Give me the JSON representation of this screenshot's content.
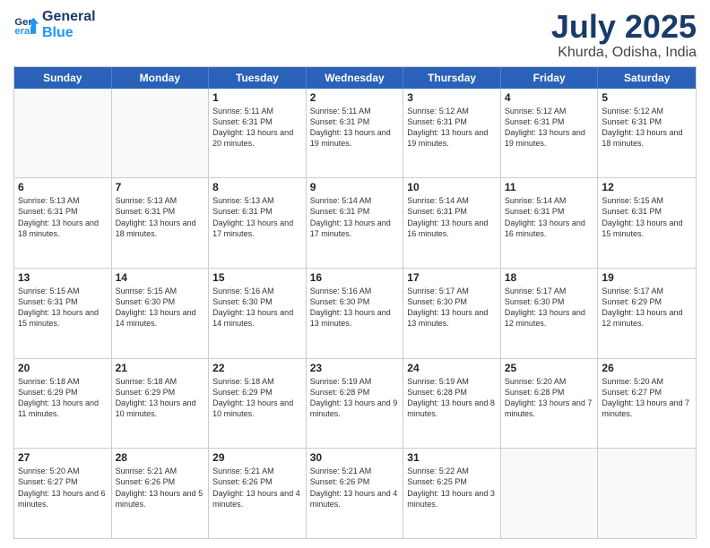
{
  "header": {
    "logo_line1": "General",
    "logo_line2": "Blue",
    "month_title": "July 2025",
    "location": "Khurda, Odisha, India"
  },
  "days_of_week": [
    "Sunday",
    "Monday",
    "Tuesday",
    "Wednesday",
    "Thursday",
    "Friday",
    "Saturday"
  ],
  "rows": [
    [
      {
        "day": "",
        "empty": true
      },
      {
        "day": "",
        "empty": true
      },
      {
        "day": "1",
        "sunrise": "Sunrise: 5:11 AM",
        "sunset": "Sunset: 6:31 PM",
        "daylight": "Daylight: 13 hours and 20 minutes."
      },
      {
        "day": "2",
        "sunrise": "Sunrise: 5:11 AM",
        "sunset": "Sunset: 6:31 PM",
        "daylight": "Daylight: 13 hours and 19 minutes."
      },
      {
        "day": "3",
        "sunrise": "Sunrise: 5:12 AM",
        "sunset": "Sunset: 6:31 PM",
        "daylight": "Daylight: 13 hours and 19 minutes."
      },
      {
        "day": "4",
        "sunrise": "Sunrise: 5:12 AM",
        "sunset": "Sunset: 6:31 PM",
        "daylight": "Daylight: 13 hours and 19 minutes."
      },
      {
        "day": "5",
        "sunrise": "Sunrise: 5:12 AM",
        "sunset": "Sunset: 6:31 PM",
        "daylight": "Daylight: 13 hours and 18 minutes."
      }
    ],
    [
      {
        "day": "6",
        "sunrise": "Sunrise: 5:13 AM",
        "sunset": "Sunset: 6:31 PM",
        "daylight": "Daylight: 13 hours and 18 minutes."
      },
      {
        "day": "7",
        "sunrise": "Sunrise: 5:13 AM",
        "sunset": "Sunset: 6:31 PM",
        "daylight": "Daylight: 13 hours and 18 minutes."
      },
      {
        "day": "8",
        "sunrise": "Sunrise: 5:13 AM",
        "sunset": "Sunset: 6:31 PM",
        "daylight": "Daylight: 13 hours and 17 minutes."
      },
      {
        "day": "9",
        "sunrise": "Sunrise: 5:14 AM",
        "sunset": "Sunset: 6:31 PM",
        "daylight": "Daylight: 13 hours and 17 minutes."
      },
      {
        "day": "10",
        "sunrise": "Sunrise: 5:14 AM",
        "sunset": "Sunset: 6:31 PM",
        "daylight": "Daylight: 13 hours and 16 minutes."
      },
      {
        "day": "11",
        "sunrise": "Sunrise: 5:14 AM",
        "sunset": "Sunset: 6:31 PM",
        "daylight": "Daylight: 13 hours and 16 minutes."
      },
      {
        "day": "12",
        "sunrise": "Sunrise: 5:15 AM",
        "sunset": "Sunset: 6:31 PM",
        "daylight": "Daylight: 13 hours and 15 minutes."
      }
    ],
    [
      {
        "day": "13",
        "sunrise": "Sunrise: 5:15 AM",
        "sunset": "Sunset: 6:31 PM",
        "daylight": "Daylight: 13 hours and 15 minutes."
      },
      {
        "day": "14",
        "sunrise": "Sunrise: 5:15 AM",
        "sunset": "Sunset: 6:30 PM",
        "daylight": "Daylight: 13 hours and 14 minutes."
      },
      {
        "day": "15",
        "sunrise": "Sunrise: 5:16 AM",
        "sunset": "Sunset: 6:30 PM",
        "daylight": "Daylight: 13 hours and 14 minutes."
      },
      {
        "day": "16",
        "sunrise": "Sunrise: 5:16 AM",
        "sunset": "Sunset: 6:30 PM",
        "daylight": "Daylight: 13 hours and 13 minutes."
      },
      {
        "day": "17",
        "sunrise": "Sunrise: 5:17 AM",
        "sunset": "Sunset: 6:30 PM",
        "daylight": "Daylight: 13 hours and 13 minutes."
      },
      {
        "day": "18",
        "sunrise": "Sunrise: 5:17 AM",
        "sunset": "Sunset: 6:30 PM",
        "daylight": "Daylight: 13 hours and 12 minutes."
      },
      {
        "day": "19",
        "sunrise": "Sunrise: 5:17 AM",
        "sunset": "Sunset: 6:29 PM",
        "daylight": "Daylight: 13 hours and 12 minutes."
      }
    ],
    [
      {
        "day": "20",
        "sunrise": "Sunrise: 5:18 AM",
        "sunset": "Sunset: 6:29 PM",
        "daylight": "Daylight: 13 hours and 11 minutes."
      },
      {
        "day": "21",
        "sunrise": "Sunrise: 5:18 AM",
        "sunset": "Sunset: 6:29 PM",
        "daylight": "Daylight: 13 hours and 10 minutes."
      },
      {
        "day": "22",
        "sunrise": "Sunrise: 5:18 AM",
        "sunset": "Sunset: 6:29 PM",
        "daylight": "Daylight: 13 hours and 10 minutes."
      },
      {
        "day": "23",
        "sunrise": "Sunrise: 5:19 AM",
        "sunset": "Sunset: 6:28 PM",
        "daylight": "Daylight: 13 hours and 9 minutes."
      },
      {
        "day": "24",
        "sunrise": "Sunrise: 5:19 AM",
        "sunset": "Sunset: 6:28 PM",
        "daylight": "Daylight: 13 hours and 8 minutes."
      },
      {
        "day": "25",
        "sunrise": "Sunrise: 5:20 AM",
        "sunset": "Sunset: 6:28 PM",
        "daylight": "Daylight: 13 hours and 7 minutes."
      },
      {
        "day": "26",
        "sunrise": "Sunrise: 5:20 AM",
        "sunset": "Sunset: 6:27 PM",
        "daylight": "Daylight: 13 hours and 7 minutes."
      }
    ],
    [
      {
        "day": "27",
        "sunrise": "Sunrise: 5:20 AM",
        "sunset": "Sunset: 6:27 PM",
        "daylight": "Daylight: 13 hours and 6 minutes."
      },
      {
        "day": "28",
        "sunrise": "Sunrise: 5:21 AM",
        "sunset": "Sunset: 6:26 PM",
        "daylight": "Daylight: 13 hours and 5 minutes."
      },
      {
        "day": "29",
        "sunrise": "Sunrise: 5:21 AM",
        "sunset": "Sunset: 6:26 PM",
        "daylight": "Daylight: 13 hours and 4 minutes."
      },
      {
        "day": "30",
        "sunrise": "Sunrise: 5:21 AM",
        "sunset": "Sunset: 6:26 PM",
        "daylight": "Daylight: 13 hours and 4 minutes."
      },
      {
        "day": "31",
        "sunrise": "Sunrise: 5:22 AM",
        "sunset": "Sunset: 6:25 PM",
        "daylight": "Daylight: 13 hours and 3 minutes."
      },
      {
        "day": "",
        "empty": true
      },
      {
        "day": "",
        "empty": true
      }
    ]
  ]
}
